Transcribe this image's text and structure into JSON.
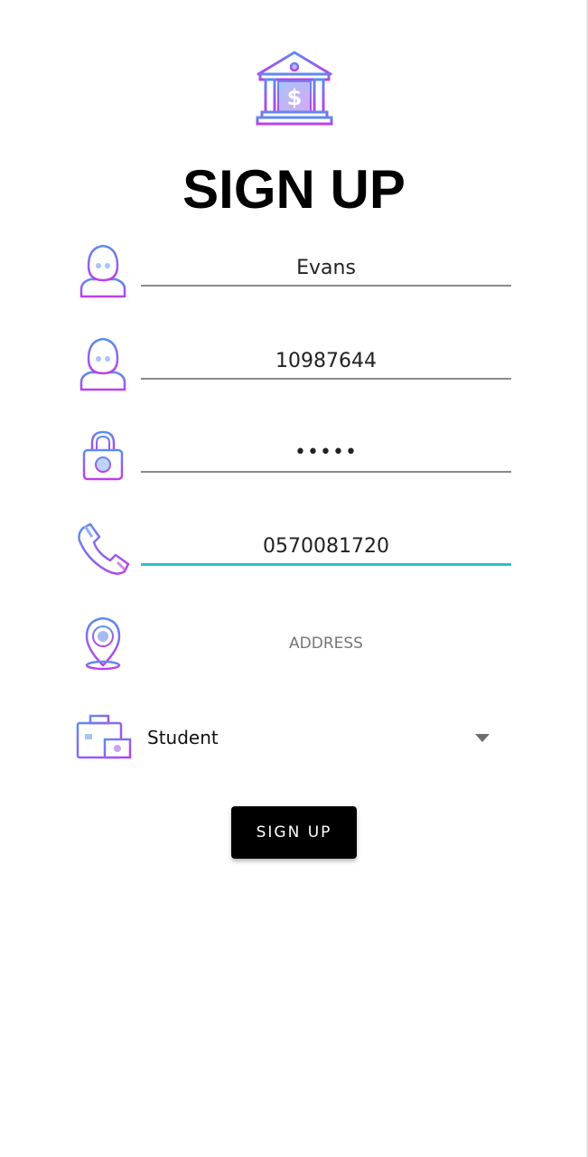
{
  "header": {
    "title": "SIGN UP",
    "logo_icon": "bank-dollar-icon"
  },
  "form": {
    "name_value": "Evans",
    "id_value": "10987644",
    "password_value": "•••••",
    "phone_value": "0570081720",
    "address_placeholder": "ADDRESS",
    "role_selected": "Student"
  },
  "icons": {
    "name": "user-icon",
    "id": "user-icon",
    "password": "padlock-icon",
    "phone": "phone-icon",
    "address": "location-pin-icon",
    "role": "briefcase-money-icon"
  },
  "actions": {
    "signup_label": "SIGN UP"
  },
  "colors": {
    "icon_gradient_start": "#5B8DEF",
    "icon_gradient_end": "#C03EE8",
    "active_underline": "#26C6C0",
    "button_bg": "#000000"
  }
}
